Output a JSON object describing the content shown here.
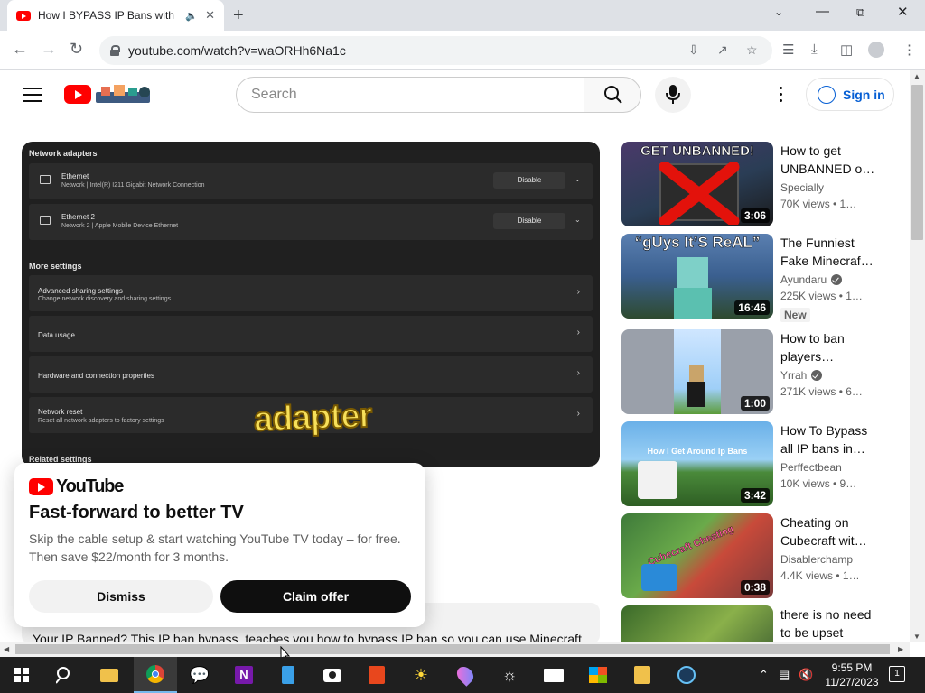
{
  "browser": {
    "tab_title": "How I BYPASS IP Bans with I",
    "url": "youtube.com/watch?v=waORHh6Na1c"
  },
  "youtube": {
    "search_placeholder": "Search",
    "sign_in": "Sign in"
  },
  "player_frame": {
    "network_adapters_heading": "Network adapters",
    "adapters": [
      {
        "name": "Ethernet",
        "detail": "Network | Intel(R) I211 Gigabit Network Connection",
        "button": "Disable"
      },
      {
        "name": "Ethernet 2",
        "detail": "Network 2 | Apple Mobile Device Ethernet",
        "button": "Disable"
      }
    ],
    "more_settings_heading": "More settings",
    "settings": [
      {
        "label": "Advanced sharing settings",
        "sub": "Change network discovery and sharing settings"
      },
      {
        "label": "Data usage",
        "sub": ""
      },
      {
        "label": "Hardware and connection properties",
        "sub": ""
      },
      {
        "label": "Network reset",
        "sub": "Reset all network adapters to factory settings"
      }
    ],
    "related_settings_heading": "Related settings",
    "overlay_caption": "adapter"
  },
  "promo": {
    "logo_word": "YouTube",
    "heading": "Fast-forward to better TV",
    "body": "Skip the cable setup & start watching YouTube TV today – for free. Then save $22/month for 3 months.",
    "dismiss": "Dismiss",
    "claim": "Claim offer"
  },
  "description": {
    "text": "Your IP Banned? This IP ban bypass, teaches you how to bypass IP ban so you can use Minecraft"
  },
  "recommendations": [
    {
      "title": "How to get UNBANNED o…",
      "channel": "Specially",
      "verified": false,
      "views": "70K views • 1…",
      "duration": "3:06",
      "thumb_text": "GET UNBANNED!",
      "new": ""
    },
    {
      "title": "The Funniest Fake Minecraf…",
      "channel": "Ayundaru",
      "verified": true,
      "views": "225K views • 1…",
      "duration": "16:46",
      "thumb_text": "“gUys It’S ReAL”",
      "new": "New"
    },
    {
      "title": "How to ban players…",
      "channel": "Yrrah",
      "verified": true,
      "views": "271K views • 6…",
      "duration": "1:00",
      "thumb_text": "",
      "new": ""
    },
    {
      "title": "How To Bypass all IP bans in…",
      "channel": "Perffectbean",
      "verified": false,
      "views": "10K views • 9…",
      "duration": "3:42",
      "thumb_text": "How I Get Around Ip Bans",
      "new": ""
    },
    {
      "title": "Cheating on Cubecraft wit…",
      "channel": "Disablerchamp",
      "verified": false,
      "views": "4.4K views • 1…",
      "duration": "0:38",
      "thumb_text": "Cubecraft Cheating",
      "new": ""
    },
    {
      "title": "there is no need to be upset",
      "channel": "",
      "verified": false,
      "views": "",
      "duration": "",
      "thumb_text": "",
      "new": ""
    }
  ],
  "taskbar": {
    "time": "9:55 PM",
    "date": "11/27/2023",
    "notification_count": "1"
  }
}
